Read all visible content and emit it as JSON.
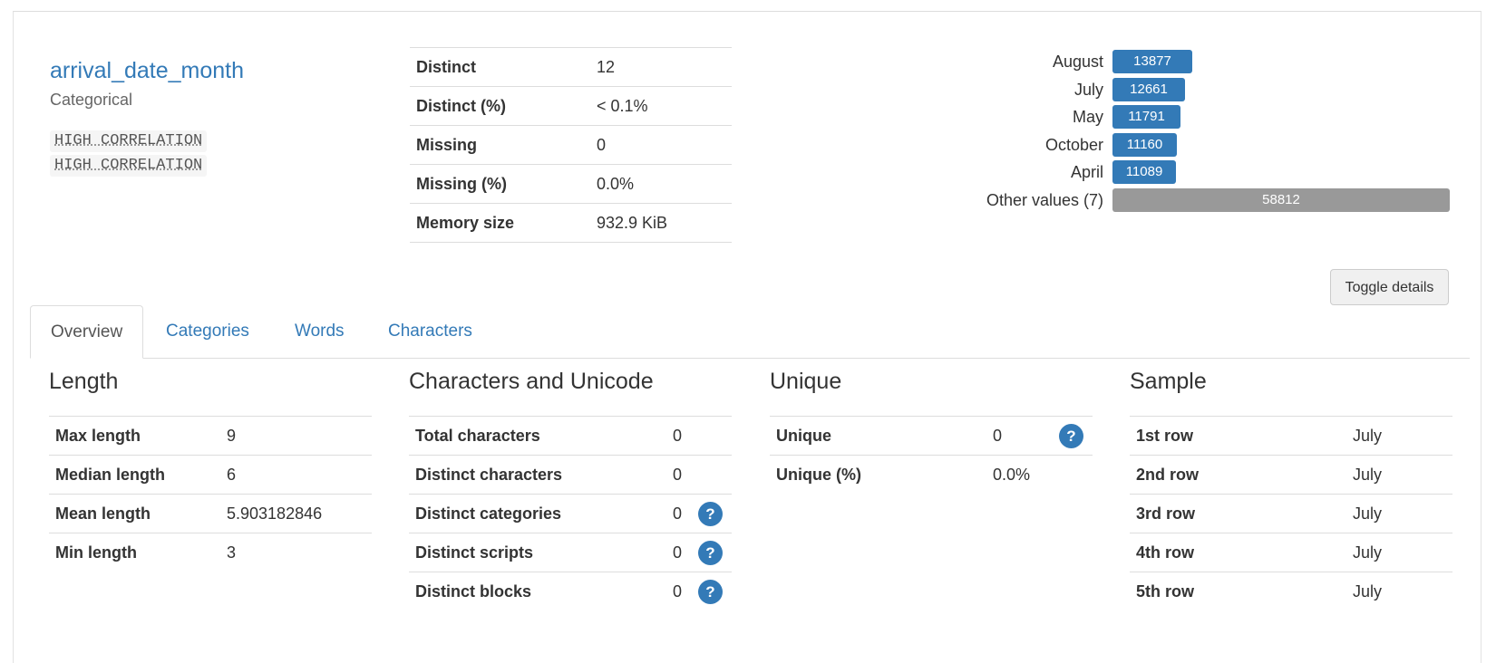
{
  "variable": {
    "name": "arrival_date_month",
    "type": "Categorical",
    "badges": [
      "HIGH CORRELATION",
      "HIGH CORRELATION"
    ]
  },
  "summary": [
    {
      "label": "Distinct",
      "value": "12"
    },
    {
      "label": "Distinct (%)",
      "value": "< 0.1%"
    },
    {
      "label": "Missing",
      "value": "0"
    },
    {
      "label": "Missing (%)",
      "value": "0.0%"
    },
    {
      "label": "Memory size",
      "value": "932.9 KiB"
    }
  ],
  "freq": [
    {
      "label": "August",
      "value": "13877",
      "count": 13877
    },
    {
      "label": "July",
      "value": "12661",
      "count": 12661
    },
    {
      "label": "May",
      "value": "11791",
      "count": 11791
    },
    {
      "label": "October",
      "value": "11160",
      "count": 11160
    },
    {
      "label": "April",
      "value": "11089",
      "count": 11089
    },
    {
      "label": "Other values (7)",
      "value": "58812",
      "count": 58812
    }
  ],
  "colors": {
    "accent": "#337ab7",
    "other_bar": "#999999"
  },
  "toggle_label": "Toggle details",
  "tabs": [
    "Overview",
    "Categories",
    "Words",
    "Characters"
  ],
  "help_icon_glyph": "?",
  "sections": {
    "length": {
      "title": "Length",
      "rows": [
        {
          "label": "Max length",
          "value": "9"
        },
        {
          "label": "Median length",
          "value": "6"
        },
        {
          "label": "Mean length",
          "value": "5.903182846"
        },
        {
          "label": "Min length",
          "value": "3"
        }
      ]
    },
    "unicode": {
      "title": "Characters and Unicode",
      "rows": [
        {
          "label": "Total characters",
          "value": "0"
        },
        {
          "label": "Distinct characters",
          "value": "0"
        },
        {
          "label": "Distinct categories",
          "value": "0",
          "help": true
        },
        {
          "label": "Distinct scripts",
          "value": "0",
          "help": true
        },
        {
          "label": "Distinct blocks",
          "value": "0",
          "help": true
        }
      ]
    },
    "unique": {
      "title": "Unique",
      "rows": [
        {
          "label": "Unique",
          "value": "0",
          "help": true
        },
        {
          "label": "Unique (%)",
          "value": "0.0%"
        }
      ]
    },
    "sample": {
      "title": "Sample",
      "rows": [
        {
          "label": "1st row",
          "value": "July"
        },
        {
          "label": "2nd row",
          "value": "July"
        },
        {
          "label": "3rd row",
          "value": "July"
        },
        {
          "label": "4th row",
          "value": "July"
        },
        {
          "label": "5th row",
          "value": "July"
        }
      ]
    }
  }
}
